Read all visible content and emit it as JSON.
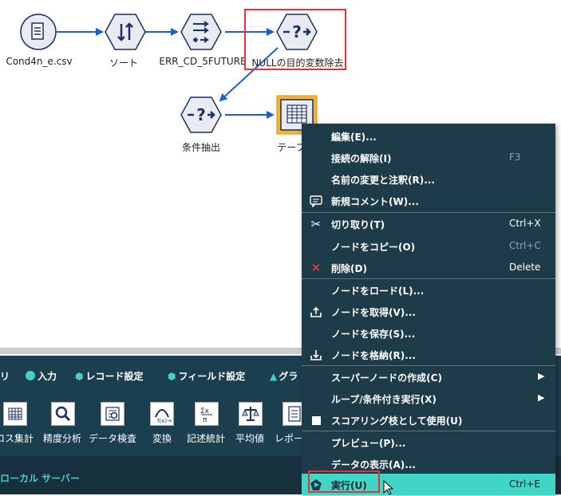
{
  "canvas": {
    "nodes": [
      {
        "id": "csv",
        "label": "Cond4n_e.csv",
        "icon": "csv-file-icon"
      },
      {
        "id": "sort",
        "label": "ソート",
        "icon": "sort-icon"
      },
      {
        "id": "err",
        "label": "ERR_CD_5FUTURE",
        "icon": "derive-icon"
      },
      {
        "id": "null",
        "label": "NULLの目的変数除去",
        "icon": "select-icon"
      },
      {
        "id": "cond",
        "label": "条件抽出",
        "icon": "select-icon"
      },
      {
        "id": "table",
        "label": "テーブ",
        "icon": "table-icon"
      }
    ]
  },
  "palette": {
    "tabs": [
      {
        "label": "リ",
        "icon": ""
      },
      {
        "label": "入力",
        "icon": "circle-icon",
        "color": "#43d1c5"
      },
      {
        "label": "レコード設定",
        "icon": "hexagon-icon",
        "color": "#43d1c5"
      },
      {
        "label": "フィールド設定",
        "icon": "hexagon-icon",
        "color": "#43d1c5"
      },
      {
        "label": "グラ",
        "icon": "triangle-icon",
        "color": "#43d1c5"
      }
    ],
    "tools": [
      {
        "label": "ロス集計",
        "icon": "crosstab-icon"
      },
      {
        "label": "精度分析",
        "icon": "magnifier-icon"
      },
      {
        "label": "データ検査",
        "icon": "data-audit-icon"
      },
      {
        "label": "変換",
        "icon": "transform-icon"
      },
      {
        "label": "記述統計",
        "icon": "statistics-icon"
      },
      {
        "label": "平均値",
        "icon": "balance-icon"
      },
      {
        "label": "レポー",
        "icon": "report-icon"
      }
    ],
    "status_text": "ローカル サーバー"
  },
  "menu": {
    "items": [
      {
        "label": "編集(E)...",
        "shortcut": "",
        "icon": ""
      },
      {
        "label": "接続の解除(I)",
        "shortcut": "F3",
        "icon": "",
        "dim": true
      },
      {
        "label": "名前の変更と注釈(R)...",
        "shortcut": "",
        "icon": ""
      },
      {
        "label": "新規コメント(W)...",
        "shortcut": "",
        "icon": "comment-icon"
      },
      {
        "label": "切り取り(T)",
        "shortcut": "Ctrl+X",
        "icon": "scissors-icon"
      },
      {
        "label": "ノードをコピー(O)",
        "shortcut": "Ctrl+C",
        "icon": "",
        "dim": true
      },
      {
        "label": "削除(D)",
        "shortcut": "Delete",
        "icon": "delete-icon"
      },
      {
        "label": "ノードをロード(L)...",
        "shortcut": "",
        "icon": ""
      },
      {
        "label": "ノードを取得(V)...",
        "shortcut": "",
        "icon": "retrieve-icon"
      },
      {
        "label": "ノードを保存(S)...",
        "shortcut": "",
        "icon": ""
      },
      {
        "label": "ノードを格納(R)...",
        "shortcut": "",
        "icon": "store-icon"
      },
      {
        "label": "スーパーノードの作成(C)",
        "shortcut": "",
        "icon": "",
        "submenu": true
      },
      {
        "label": "ループ/条件付き実行(X)",
        "shortcut": "",
        "icon": "",
        "submenu": true
      },
      {
        "label": "スコアリング枝として使用(U)",
        "shortcut": "",
        "icon": "scoring-icon"
      },
      {
        "label": "プレビュー(P)...",
        "shortcut": "",
        "icon": ""
      },
      {
        "label": "データの表示(A)...",
        "shortcut": "",
        "icon": ""
      },
      {
        "label": "実行(U)",
        "shortcut": "Ctrl+E",
        "icon": "run-icon",
        "highlighted": true
      }
    ]
  },
  "colors": {
    "accent": "#43d1c5",
    "menu_bg": "#1d3b49",
    "highlight": "#3fd6c6",
    "selection": "#e0333a",
    "node_selected": "#f5b335",
    "arrow": "#1a5fd6",
    "node_icon": "#1a2f6b"
  }
}
